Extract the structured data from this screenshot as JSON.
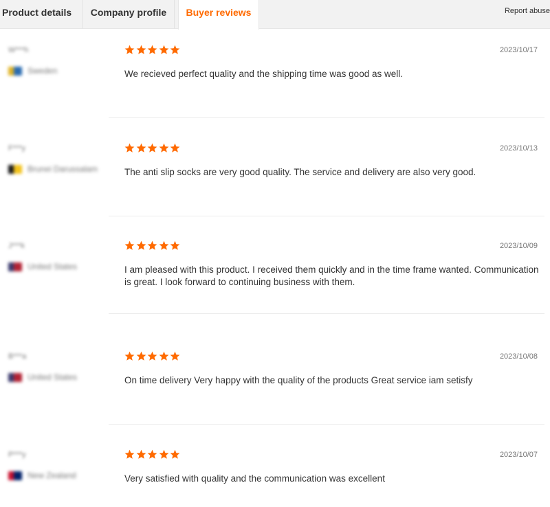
{
  "tabs": [
    {
      "label": "Product details"
    },
    {
      "label": "Company profile"
    },
    {
      "label": "Buyer reviews",
      "active": true
    }
  ],
  "report_label": "Report abuse",
  "colors": {
    "accent": "#ff6a00",
    "star": "#ff6a00"
  },
  "reviews": [
    {
      "user": "W***h",
      "country": "Sweden",
      "flag_colors": [
        "#2b6cb0",
        "#e0b428"
      ],
      "rating": 5,
      "date": "2023/10/17",
      "text": "We recieved perfect quality and the shipping time was good as well."
    },
    {
      "user": "F***y",
      "country": "Brunei Darussalam",
      "flag_colors": [
        "#f2c21b",
        "#1a1a1a"
      ],
      "rating": 5,
      "date": "2023/10/13",
      "text": "The anti slip socks are very good quality. The service and delivery are also very good."
    },
    {
      "user": "J***k",
      "country": "United States",
      "flag_colors": [
        "#b22234",
        "#3c3b6e"
      ],
      "rating": 5,
      "date": "2023/10/09",
      "text": "I am pleased with this product. I received them quickly and in the time frame wanted. Communication is great. I look forward to continuing business with them."
    },
    {
      "user": "B***a",
      "country": "United States",
      "flag_colors": [
        "#b22234",
        "#3c3b6e"
      ],
      "rating": 5,
      "date": "2023/10/08",
      "text": "On time delivery Very happy with the quality of the products Great service iam setisfy"
    },
    {
      "user": "P***y",
      "country": "New Zealand",
      "flag_colors": [
        "#012169",
        "#c8102e"
      ],
      "rating": 5,
      "date": "2023/10/07",
      "text": "Very satisfied with quality and the communication was excellent"
    }
  ]
}
